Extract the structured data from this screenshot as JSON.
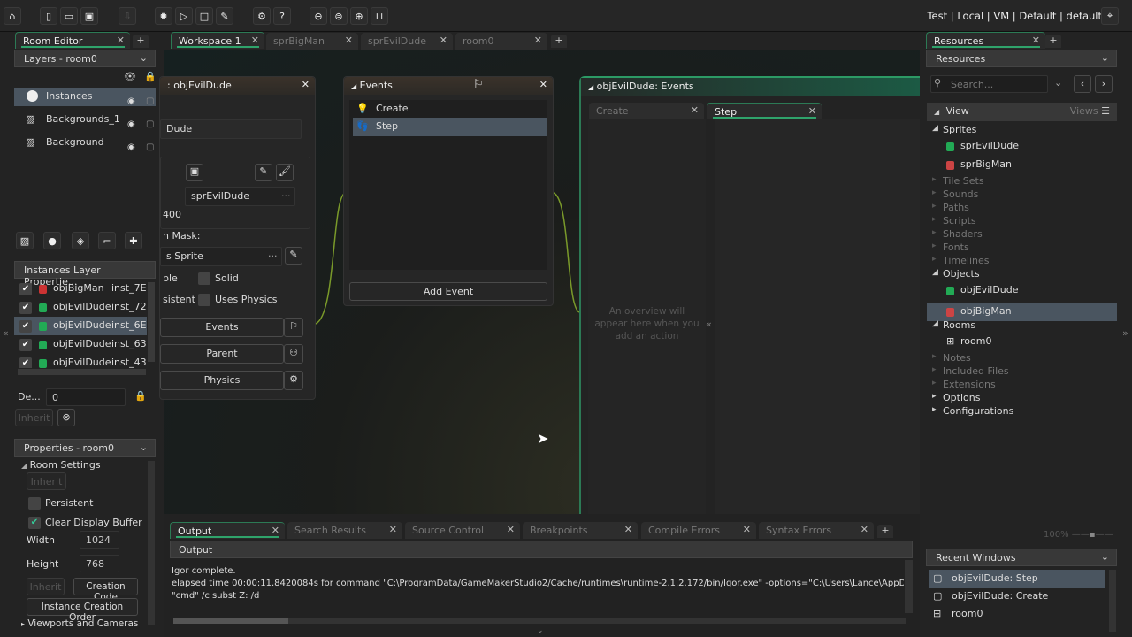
{
  "toolbar": {
    "icons": [
      "home-icon",
      "new-project-icon",
      "open-project-icon",
      "save-icon",
      "export-icon",
      "debug-icon",
      "run-icon",
      "stop-icon",
      "clean-icon",
      "settings-icon",
      "help-icon",
      "zoom-out-icon",
      "zoom-reset-icon",
      "zoom-in-icon",
      "gamepad-icon"
    ],
    "target": [
      "Test",
      "Local",
      "VM",
      "Default",
      "default"
    ],
    "target_separator": "|"
  },
  "left": {
    "tab": "Room Editor",
    "layers_header": "Layers - room0",
    "layers": [
      {
        "label": "Instances",
        "selected": true
      },
      {
        "label": "Backgrounds_1"
      },
      {
        "label": "Background"
      }
    ],
    "instances_header": "Instances Layer Propertie...",
    "instances": [
      {
        "object": "objBigMan",
        "id": "inst_7E(",
        "checked": true
      },
      {
        "object": "objEvilDude",
        "id": "inst_72(",
        "checked": true
      },
      {
        "object": "objEvilDude",
        "id": "inst_6E2",
        "checked": true,
        "selected": true
      },
      {
        "object": "objEvilDude",
        "id": "inst_63:",
        "checked": true
      },
      {
        "object": "objEvilDude",
        "id": "inst_43(",
        "checked": true
      }
    ],
    "depth_label": "De...",
    "depth_value": "0",
    "inherit": "Inherit",
    "properties_header": "Properties - room0",
    "room_settings": "Room Settings",
    "persistent": "Persistent",
    "persistent_checked": false,
    "clear_display_buffer": "Clear Display Buffer",
    "clear_checked": true,
    "width_label": "Width",
    "width": "1024",
    "height_label": "Height",
    "height": "768",
    "creation_code": "Creation Code",
    "instance_creation_order": "Instance Creation Order",
    "viewports": "Viewports and Cameras"
  },
  "workspace": {
    "tabs": [
      {
        "label": "Workspace 1",
        "active": true
      },
      {
        "label": "sprBigMan"
      },
      {
        "label": "sprEvilDude"
      },
      {
        "label": "room0"
      }
    ],
    "object_editor": {
      "title": ": objEvilDude",
      "name": "Dude",
      "sprite": "sprEvilDude",
      "size": "400",
      "mask_label": "n Mask:",
      "mask_value": "s Sprite",
      "visible": "ble",
      "solid": "Solid",
      "persistent": "sistent",
      "uses_physics": "Uses Physics",
      "events": "Events",
      "parent": "Parent",
      "physics": "Physics"
    },
    "events": {
      "title": "Events",
      "items": [
        {
          "label": "Create",
          "icon": "lightbulb-icon"
        },
        {
          "label": "Step",
          "icon": "footsteps-icon",
          "selected": true
        }
      ],
      "add_event": "Add Event"
    },
    "event_editor": {
      "title": "objEvilDude: Events",
      "tabs": [
        {
          "label": "Create"
        },
        {
          "label": "Step",
          "active": true
        }
      ],
      "overview": "An overview will appear here when you add an action"
    }
  },
  "output": {
    "tabs": [
      {
        "label": "Output",
        "active": true
      },
      {
        "label": "Search Results"
      },
      {
        "label": "Source Control"
      },
      {
        "label": "Breakpoints"
      },
      {
        "label": "Compile Errors"
      },
      {
        "label": "Syntax Errors"
      }
    ],
    "header": "Output",
    "lines": [
      "Igor complete.",
      "elapsed time 00:00:11.8420084s for command \"C:\\ProgramData/GameMakerStudio2/Cache/runtimes\\runtime-2.1.2.172/bin/Igor.exe\" -options=\"C:\\Users\\Lance\\AppDa",
      "\"cmd\"  /c subst Z: /d"
    ]
  },
  "resources": {
    "tab": "Resources",
    "header": "Resources",
    "search_placeholder": "Search...",
    "view": "View",
    "views": "Views",
    "tree": [
      {
        "label": "Sprites",
        "type": "group",
        "open": true
      },
      {
        "label": "sprEvilDude",
        "type": "item"
      },
      {
        "label": "sprBigMan",
        "type": "item"
      },
      {
        "label": "Tile Sets",
        "type": "empty"
      },
      {
        "label": "Sounds",
        "type": "empty"
      },
      {
        "label": "Paths",
        "type": "empty"
      },
      {
        "label": "Scripts",
        "type": "empty"
      },
      {
        "label": "Shaders",
        "type": "empty"
      },
      {
        "label": "Fonts",
        "type": "empty"
      },
      {
        "label": "Timelines",
        "type": "empty"
      },
      {
        "label": "Objects",
        "type": "group",
        "open": true
      },
      {
        "label": "objEvilDude",
        "type": "item"
      },
      {
        "label": "objBigMan",
        "type": "item",
        "selected": true
      },
      {
        "label": "Rooms",
        "type": "group",
        "open": true
      },
      {
        "label": "room0",
        "type": "item"
      },
      {
        "label": "Notes",
        "type": "empty"
      },
      {
        "label": "Included Files",
        "type": "empty"
      },
      {
        "label": "Extensions",
        "type": "empty"
      },
      {
        "label": "Options",
        "type": "group"
      },
      {
        "label": "Configurations",
        "type": "group"
      }
    ],
    "zoom": "100%",
    "recent_header": "Recent Windows",
    "recent": [
      {
        "label": "objEvilDude: Step",
        "selected": true
      },
      {
        "label": "objEvilDude: Create"
      },
      {
        "label": "room0"
      }
    ]
  },
  "colors": {
    "accent": "#2fa36b",
    "selection": "#4a5560",
    "background": "#262626"
  }
}
